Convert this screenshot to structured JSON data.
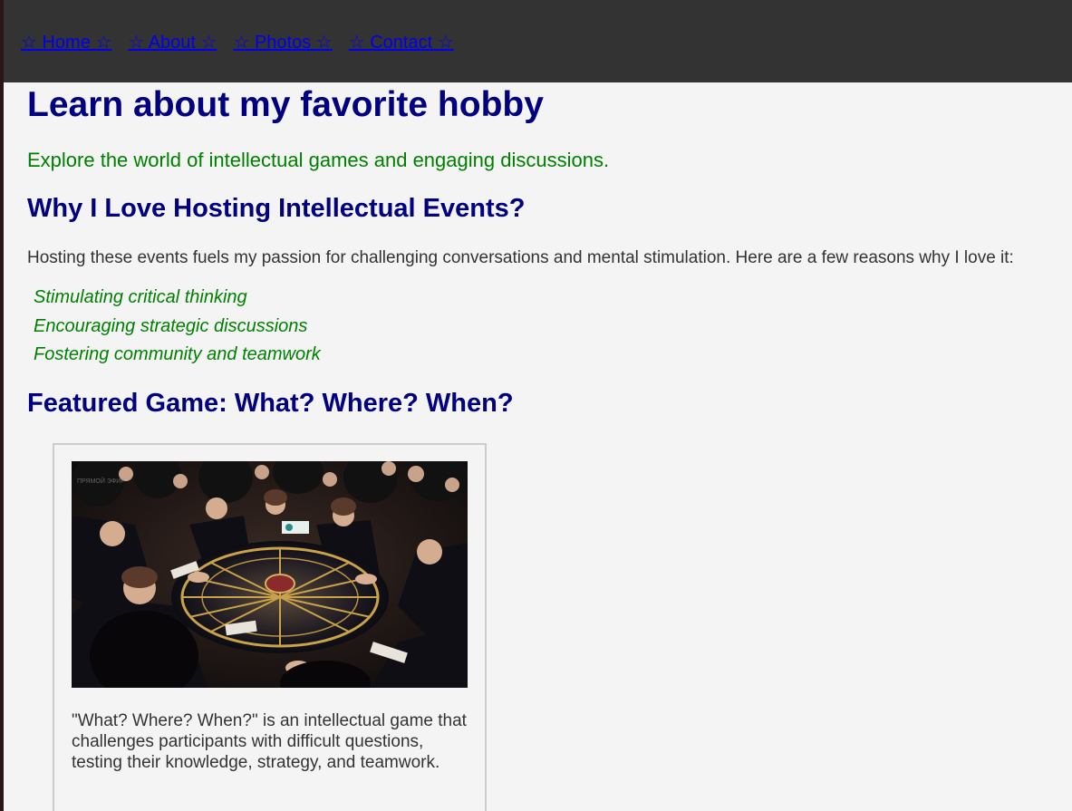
{
  "nav": {
    "items": [
      {
        "label": "☆ Home ☆"
      },
      {
        "label": "☆ About ☆"
      },
      {
        "label": "☆ Photos ☆"
      },
      {
        "label": "☆ Contact ☆"
      }
    ]
  },
  "header": {
    "title": "Learn about my favorite hobby",
    "subtitle": "Explore the world of intellectual games and engaging discussions."
  },
  "why": {
    "heading": "Why I Love Hosting Intellectual Events?",
    "intro": "Hosting these events fuels my passion for challenging conversations and mental stimulation. Here are a few reasons why I love it:",
    "reasons": [
      "Stimulating critical thinking",
      "Encouraging strategic discussions",
      "Fostering community and teamwork"
    ]
  },
  "featured": {
    "heading": "Featured Game: What? Where? When?",
    "image_icon": "photo-game-table",
    "description": "\"What? Where? When?\" is an intellectual game that challenges participants with difficult questions, testing their knowledge, strategy, and teamwork."
  },
  "colors": {
    "navbar_bg": "#333333",
    "link": "#0000ee",
    "heading": "#000080",
    "accent_green": "#008000",
    "text": "#333333",
    "page_bg": "#f4f4f4"
  }
}
